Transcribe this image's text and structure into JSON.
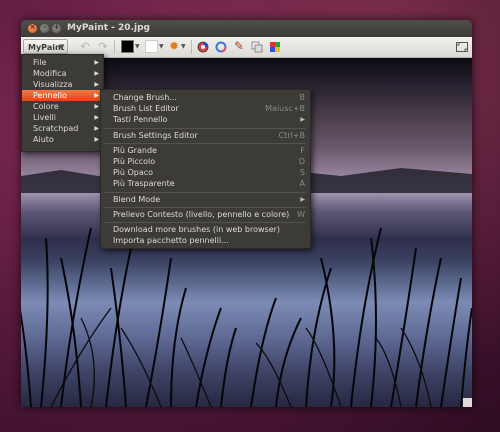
{
  "window": {
    "title": "MyPaint - 20.jpg"
  },
  "toolbar": {
    "app_menu_label": "MyPaint",
    "items": [
      {
        "name": "undo-icon"
      },
      {
        "name": "redo-icon"
      },
      {
        "name": "color-swatch"
      },
      {
        "name": "brush-swatch"
      },
      {
        "name": "gear-icon"
      },
      {
        "name": "color-wheel-icon"
      },
      {
        "name": "color-ring-icon"
      },
      {
        "name": "brush-icon"
      },
      {
        "name": "layers-icon"
      },
      {
        "name": "palette-icon"
      },
      {
        "name": "fullscreen-icon"
      }
    ],
    "colors": {
      "active_color": "#000000",
      "brush": "#ffffff"
    }
  },
  "main_menu": {
    "items": [
      {
        "label": "File",
        "has_submenu": true
      },
      {
        "label": "Modifica",
        "has_submenu": true
      },
      {
        "label": "Visualizza",
        "has_submenu": true
      },
      {
        "label": "Pennello",
        "has_submenu": true,
        "active": true
      },
      {
        "label": "Colore",
        "has_submenu": true
      },
      {
        "label": "Livelli",
        "has_submenu": true
      },
      {
        "label": "Scratchpad",
        "has_submenu": true
      },
      {
        "label": "Aiuto",
        "has_submenu": true
      }
    ]
  },
  "brush_menu": {
    "items": [
      {
        "label": "Change Brush...",
        "accel": "B"
      },
      {
        "label": "Brush List Editor",
        "accel": "Maiusc+B"
      },
      {
        "label": "Tasti Pennello",
        "submenu": true
      },
      {
        "label": "Brush Settings Editor",
        "accel": "Ctrl+B"
      },
      {
        "label": "Più Grande",
        "accel": "F"
      },
      {
        "label": "Più Piccolo",
        "accel": "D"
      },
      {
        "label": "Più Opaco",
        "accel": "S"
      },
      {
        "label": "Più Trasparente",
        "accel": "A"
      },
      {
        "label": "Blend Mode",
        "submenu": true
      },
      {
        "label": "Prelievo Contesto (livello, pennello e colore)",
        "accel": "W"
      },
      {
        "label": "Download more brushes (in web browser)"
      },
      {
        "label": "Importa pacchetto pennelli..."
      }
    ]
  },
  "theme": {
    "accent": "#dd4814",
    "menu_bg": "#3c3b37",
    "text": "#dfdbd2"
  }
}
